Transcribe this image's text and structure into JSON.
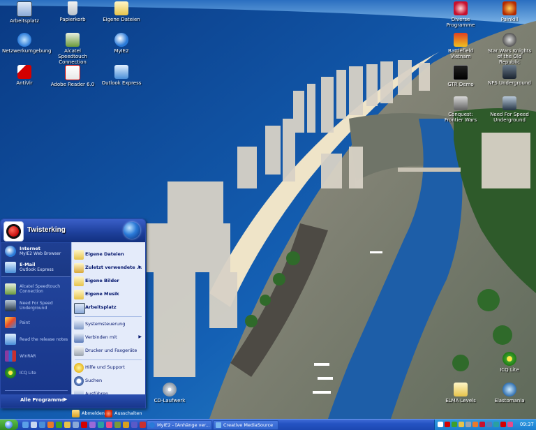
{
  "desktop": {
    "icons_left": [
      {
        "label": "Arbeitsplatz",
        "icon": "computer-icon"
      },
      {
        "label": "Papierkorb",
        "icon": "recycle-bin-icon"
      },
      {
        "label": "Eigene Dateien",
        "icon": "documents-folder-icon"
      },
      {
        "label": "Netzwerkumgebung",
        "icon": "network-icon"
      },
      {
        "label": "Alcatel Speedtouch Connection",
        "icon": "speedtouch-icon"
      },
      {
        "label": "MyIE2",
        "icon": "myie2-icon"
      },
      {
        "label": "AntiVir",
        "icon": "antivir-icon"
      },
      {
        "label": "Adobe Reader 6.0",
        "icon": "adobe-reader-icon"
      },
      {
        "label": "Outlook Express",
        "icon": "outlook-express-icon"
      }
    ],
    "icons_right": [
      {
        "label": "Diverse Programme",
        "icon": "programs-folder-icon"
      },
      {
        "label": "Painkill",
        "icon": "painkiller-icon"
      },
      {
        "label": "Battlefield Vietnam",
        "icon": "battlefield-icon"
      },
      {
        "label": "Star Wars Knights of the Old Republic",
        "icon": "star-wars-icon"
      },
      {
        "label": "GTR Demo",
        "icon": "gtr-icon"
      },
      {
        "label": "NFS Underground",
        "icon": "nfs-icon"
      },
      {
        "label": "Conquest: Frontier Wars",
        "icon": "conquest-icon"
      },
      {
        "label": "Need For Speed Underground",
        "icon": "nfs-underground-icon"
      },
      {
        "label": "ICQ Lite",
        "icon": "icq-icon"
      },
      {
        "label": "ELMA Levels",
        "icon": "folder-icon"
      },
      {
        "label": "Elastomania",
        "icon": "elastomania-icon"
      }
    ],
    "icon_bottom": {
      "label": "CD-Laufwerk",
      "icon": "cd-drive-icon"
    }
  },
  "start_menu": {
    "user_name": "Twisterking",
    "pinned": [
      {
        "title": "Internet",
        "subtitle": "MyIE2 Web Browser",
        "icon": "myie2-icon"
      },
      {
        "title": "E-Mail",
        "subtitle": "Outlook Express",
        "icon": "outlook-express-icon"
      }
    ],
    "recent": [
      {
        "label": "Alcatel Speedtouch Connection",
        "icon": "speedtouch-icon"
      },
      {
        "label": "Need For Speed Underground",
        "icon": "nfs-underground-icon"
      },
      {
        "label": "Paint",
        "icon": "paint-icon"
      },
      {
        "label": "Read the release notes",
        "icon": "notes-icon"
      },
      {
        "label": "WinRAR",
        "icon": "winrar-icon"
      },
      {
        "label": "ICQ Lite",
        "icon": "icq-icon"
      }
    ],
    "all_programs": "Alle Programme",
    "right_items_top": [
      {
        "label": "Eigene Dateien",
        "icon": "documents-folder-icon",
        "arrow": false
      },
      {
        "label": "Zuletzt verwendete ...",
        "icon": "recent-documents-icon",
        "arrow": true
      },
      {
        "label": "Eigene Bilder",
        "icon": "pictures-folder-icon",
        "arrow": false
      },
      {
        "label": "Eigene Musik",
        "icon": "music-folder-icon",
        "arrow": false
      },
      {
        "label": "Arbeitsplatz",
        "icon": "computer-icon",
        "arrow": false
      }
    ],
    "right_items_middle": [
      {
        "label": "Systemsteuerung",
        "icon": "control-panel-icon",
        "arrow": false
      },
      {
        "label": "Verbinden mit",
        "icon": "connect-icon",
        "arrow": true
      },
      {
        "label": "Drucker und Faxgeräte",
        "icon": "printer-icon",
        "arrow": false
      }
    ],
    "right_items_bottom": [
      {
        "label": "Hilfe und Support",
        "icon": "help-icon",
        "arrow": false
      },
      {
        "label": "Suchen",
        "icon": "search-icon",
        "arrow": false
      },
      {
        "label": "Ausführen...",
        "icon": "run-icon",
        "arrow": false
      }
    ],
    "logoff": "Abmelden",
    "shutdown": "Ausschalten"
  },
  "taskbar": {
    "tasks": [
      {
        "label": "MyIE2 - [Anhänge ver...",
        "icon": "myie2-icon"
      },
      {
        "label": "Creative MediaSource",
        "icon": "mediasource-icon"
      }
    ],
    "clock": "09:37"
  },
  "colors": {
    "taskbar": "#2553c2",
    "start_button": "#3a9a2c",
    "start_menu_left": "#1d3f9a",
    "start_menu_right": "#e4ebfa"
  }
}
